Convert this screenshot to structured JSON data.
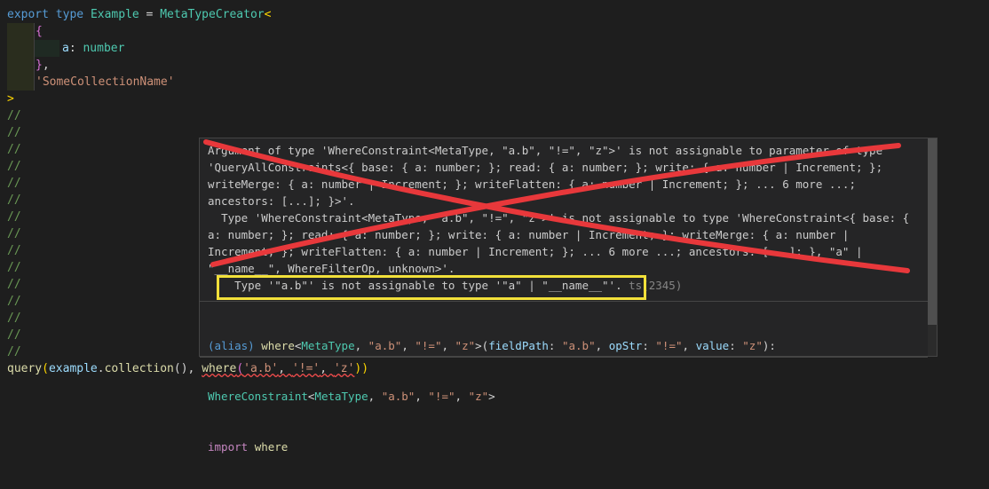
{
  "colors": {
    "background": "#1e1e1e",
    "hover_bg": "#252526",
    "cross": "#e8383b",
    "highlight": "#f2e03a"
  },
  "code": {
    "l1": {
      "kw_export": "export",
      "kw_type": "type",
      "name": "Example",
      "eq": " = ",
      "generic": "MetaTypeCreator",
      "open": "<"
    },
    "l2": {
      "brace": "{"
    },
    "l3": {
      "prop": "a",
      "colon": ": ",
      "type": "number"
    },
    "l4": {
      "brace": "}",
      "comma": ","
    },
    "l5": {
      "str": "'SomeCollectionName'"
    },
    "l6": {
      "close": ">"
    },
    "comment": "//",
    "last": {
      "fn_query": "query",
      "open": "(",
      "obj": "example",
      "dot": ".",
      "member": "collection",
      "call": "(), ",
      "fn_where": "where",
      "open2": "(",
      "arg1": "'a.b'",
      "sep1": ", ",
      "arg2": "'!='",
      "sep2": ", ",
      "arg3": "'z'",
      "close": "))"
    }
  },
  "hover": {
    "error_text": "Argument of type 'WhereConstraint<MetaType, \"a.b\", \"!=\", \"z\">' is not assignable to parameter of type 'QueryAllConstraints<{ base: { a: number; }; read: { a: number; }; write: { a: number | Increment; }; writeMerge: { a: number | Increment; }; writeFlatten: { a: number | Increment; }; ... 6 more ...; ancestors: [...]; }>'.\n  Type 'WhereConstraint<MetaType, \"a.b\", \"!=\", \"z\">' is not assignable to type 'WhereConstraint<{ base: { a: number; }; read: { a: number; }; write: { a: number | Increment; }; writeMerge: { a: number | Increment; }; writeFlatten: { a: number | Increment; }; ... 6 more ...; ancestors: [...]; }, \"a\" | \"__name__\", WhereFilterOp, unknown>'.\n    Type '\"a.b\"' is not assignable to type '\"a\" | \"__name__\"'.",
    "error_code": "ts(2345)",
    "sig_line1": {
      "alias": "(alias) ",
      "fn": "where",
      "lt": "<",
      "meta": "MetaType",
      "rest1": ", ",
      "s1": "\"a.b\"",
      "c1": ", ",
      "s2": "\"!=\"",
      "c2": ", ",
      "s3": "\"z\"",
      "gt": ">(",
      "p1": "fieldPath",
      "col1": ": ",
      "v1": "\"a.b\"",
      "c3": ", ",
      "p2": "opStr",
      "col2": ": ",
      "v2": "\"!=\"",
      "c4": ", ",
      "p3": "value",
      "col3": ": ",
      "v3": "\"z\"",
      "end": "):"
    },
    "sig_line2": {
      "type": "WhereConstraint",
      "lt": "<",
      "meta": "MetaType",
      "c1": ", ",
      "s1": "\"a.b\"",
      "c2": ", ",
      "s2": "\"!=\"",
      "c3": ", ",
      "s3": "\"z\"",
      "gt": ">"
    },
    "sig_line3": {
      "kw": "import",
      "space": " ",
      "name": "where"
    }
  }
}
